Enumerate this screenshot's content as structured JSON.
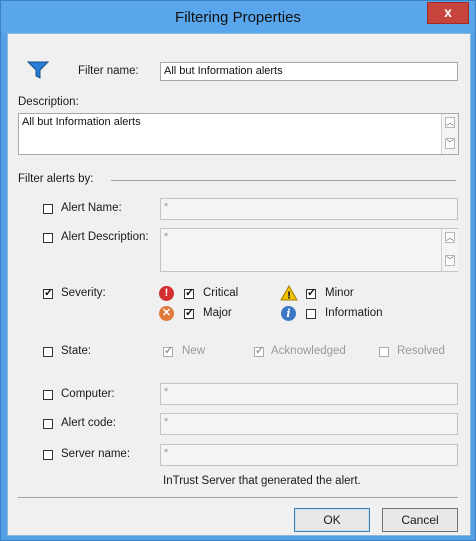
{
  "window": {
    "title": "Filtering Properties",
    "close": "x"
  },
  "filter_name": {
    "label": "Filter name:",
    "value": "All but Information alerts"
  },
  "description": {
    "label": "Description:",
    "value": "All but Information alerts"
  },
  "filter_by_label": "Filter alerts by:",
  "alert_name": {
    "label": "Alert Name:",
    "checked": false,
    "value": "*"
  },
  "alert_description": {
    "label": "Alert Description:",
    "checked": false,
    "value": "*"
  },
  "severity": {
    "label": "Severity:",
    "checked": true,
    "critical": {
      "label": "Critical",
      "checked": true
    },
    "major": {
      "label": "Major",
      "checked": true
    },
    "minor": {
      "label": "Minor",
      "checked": true
    },
    "information": {
      "label": "Information",
      "checked": false
    },
    "icons": {
      "critical": "exclamation",
      "major": "x",
      "minor": "!",
      "information": "i"
    }
  },
  "state": {
    "label": "State:",
    "checked": false,
    "new": {
      "label": "New",
      "checked": true
    },
    "acknowledged": {
      "label": "Acknowledged",
      "checked": true
    },
    "resolved": {
      "label": "Resolved",
      "checked": false
    }
  },
  "computer": {
    "label": "Computer:",
    "checked": false,
    "value": "*"
  },
  "alert_code": {
    "label": "Alert code:",
    "checked": false,
    "value": "*"
  },
  "server_name": {
    "label": "Server name:",
    "checked": false,
    "value": "*",
    "hint": "InTrust Server that generated the alert."
  },
  "buttons": {
    "ok": "OK",
    "cancel": "Cancel"
  },
  "colors": {
    "titlebar": "#5aa6ec",
    "close": "#c7443c",
    "critical": "#d32f2f",
    "major": "#e0793a",
    "minor": "#f2c200",
    "information": "#3b78c4"
  }
}
